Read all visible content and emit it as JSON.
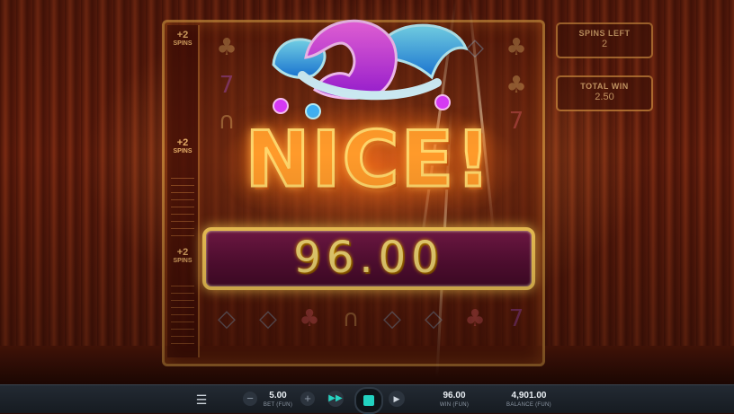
{
  "game": {
    "win_message": "NICE!",
    "win_amount": "96.00"
  },
  "side_panels": {
    "spins_left_label": "SPINS LEFT",
    "spins_left_value": "2",
    "total_win_label": "TOTAL WIN",
    "total_win_value": "2.50"
  },
  "spin_meter": {
    "tags": [
      {
        "big": "+2",
        "small": "SPINS"
      },
      {
        "big": "+2",
        "small": "SPINS"
      },
      {
        "big": "+2",
        "small": "SPINS"
      }
    ]
  },
  "reel_symbols": [
    "clover-icon",
    "seven-icon",
    "horseshoe-icon",
    "diamond-icon",
    "cherry-icon"
  ],
  "bottom_bar": {
    "menu_icon": "menu-icon",
    "minus_label": "−",
    "plus_label": "+",
    "bet": {
      "value": "5.00",
      "label": "BET (FUN)"
    },
    "turbo_icon": "fast-forward-icon",
    "spin_icon": "stop-icon",
    "autoplay_icon": "play-icon",
    "win": {
      "value": "96.00",
      "label": "WIN (FUN)"
    },
    "balance": {
      "value": "4,901.00",
      "label": "BALANCE (FUN)"
    }
  },
  "colors": {
    "accent": "#22d2c0",
    "banner_gold": "#ffcf5a",
    "banner_purple": "#6a1440",
    "nice_orange": "#ff9a2a"
  }
}
